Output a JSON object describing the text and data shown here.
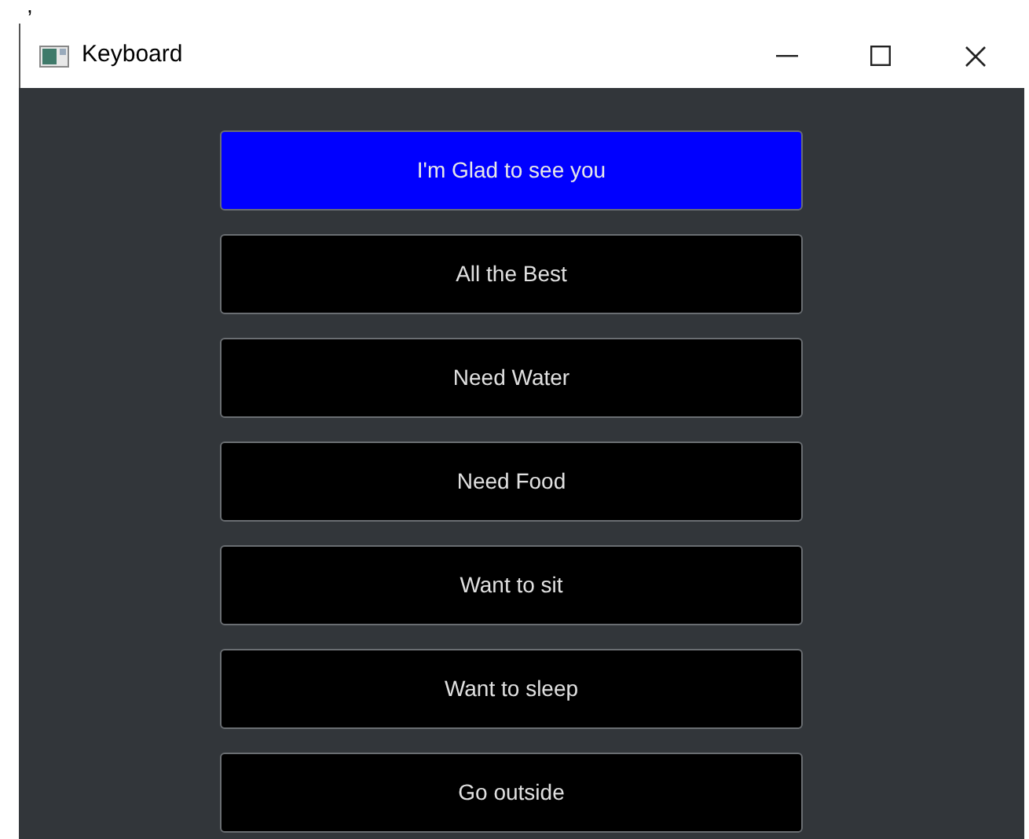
{
  "stray_mark": ",",
  "window": {
    "title": "Keyboard"
  },
  "buttons": [
    {
      "label": "I'm Glad to see you",
      "selected": true
    },
    {
      "label": "All the Best",
      "selected": false
    },
    {
      "label": "Need Water",
      "selected": false
    },
    {
      "label": "Need Food",
      "selected": false
    },
    {
      "label": "Want to sit",
      "selected": false
    },
    {
      "label": "Want to sleep",
      "selected": false
    },
    {
      "label": "Go outside",
      "selected": false
    }
  ]
}
